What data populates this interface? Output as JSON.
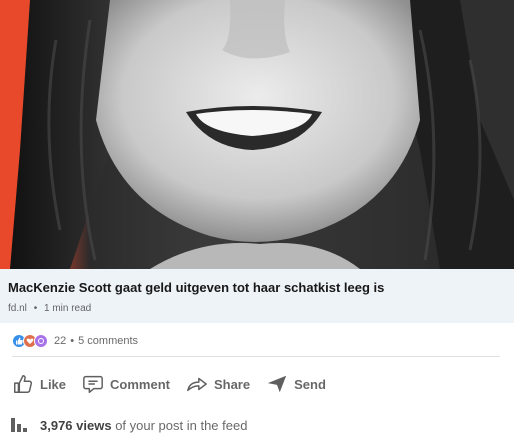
{
  "post": {
    "image": {
      "icon": "portrait-photo-image",
      "accent_color": "#e8492a"
    },
    "article": {
      "title": "MacKenzie Scott gaat geld uitgeven tot haar schatkist leeg is",
      "source": "fd.nl",
      "read_time": "1 min read"
    },
    "social": {
      "reaction_count": "22",
      "comments": "5 comments",
      "reaction_icons": [
        "like-reaction-icon",
        "love-reaction-icon",
        "support-reaction-icon"
      ]
    },
    "actions": {
      "like": "Like",
      "comment": "Comment",
      "share": "Share",
      "send": "Send"
    },
    "analytics": {
      "views_count": "3,976 views",
      "views_suffix": "of your post in the feed",
      "icon": "bar-chart-icon"
    }
  }
}
